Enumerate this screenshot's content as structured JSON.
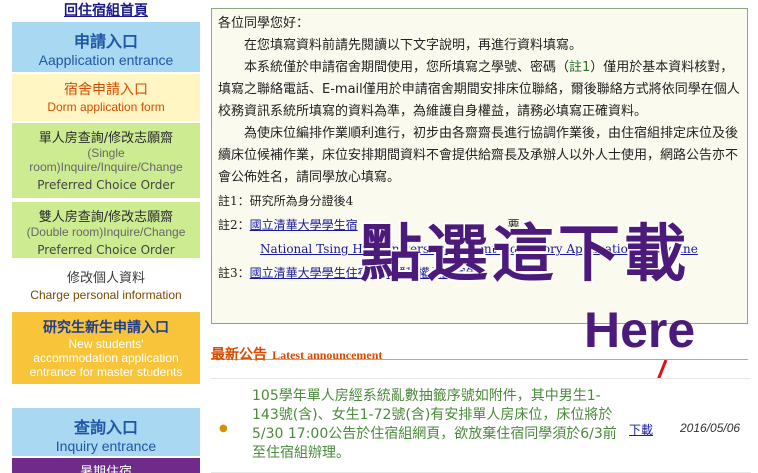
{
  "sidebar": {
    "home_link": "回住宿組首頁",
    "application_entrance": {
      "zh": "申請入口",
      "en": "Aapplication entrance"
    },
    "dorm_form": {
      "zh": "宿舍申請入口",
      "en": "Dorm application form"
    },
    "single_room": {
      "zh": "單人房查詢/修改志願齋",
      "en1": "(Single",
      "en2": "room)Inquire/Inquire/Change",
      "en3": "Preferred Choice Order"
    },
    "double_room": {
      "zh": "雙人房查詢/修改志願齋",
      "en1": "(Double room)Inquire/Change",
      "en2": "Preferred Choice Order"
    },
    "personal_data": {
      "zh": "修改個人資料",
      "en": "Charge personal information"
    },
    "grad_application": {
      "zh": "研究生新生申請入口",
      "en1": "New students'",
      "en2": "accommodation application",
      "en3": "entrance for master students"
    },
    "inquiry_entrance": {
      "zh": "查詢入口",
      "en": "Inquiry entrance"
    },
    "summer": {
      "zh": "暑期住宿"
    }
  },
  "notice": {
    "greeting": "各位同學您好：",
    "p1": "在您填寫資料前請先閱讀以下文字說明，再進行資料填寫。",
    "p2_a": "本系統僅於申請宿舍期間使用，您所填寫之學號、密碼（",
    "p2_note": "註1",
    "p2_b": "）僅用於基本資料核對，填寫之聯絡電話、E-mail僅用於申請宿舍期間安排床位聯絡，爾後聯絡方式將依同學在個人校務資訊系統所填寫的資料為準，為維護自身權益，請務必填寫正確資料。",
    "p3": "為使床位編排作業順利進行，初步由各齋齋長進行協調作業後，由住宿組排定床位及後續床位候補作業，床位安排期間資料不會提供給齋長及承辦人以外人士使用，網路公告亦不會公佈姓名，請同學放心填寫。",
    "note1_label": "註1：",
    "note1_text": "研究所為身分證後4",
    "note2_label": "註2：",
    "note2_link": "國立清華大學學生宿",
    "note2_suffix": "要",
    "note2_en_link": "National Tsing Hua University Student Dormitory Application Guideline",
    "note3_label": "註3：",
    "note3_link": "國立清華大學學生住宿資訊隱私權保護宣告",
    "note3_end": "。"
  },
  "overlay": {
    "zh": "點選這下載",
    "en": "Here"
  },
  "announcement": {
    "title_zh": "最新公告",
    "title_en": "Latest announcement",
    "items": [
      {
        "text": "105學年單人房經系統亂數抽籤序號如附件，其中男生1-143號(含)、女生1-72號(含)有安排單人房床位，床位將於5/30 17:00公告於住宿組網頁，欲放棄住宿同學須於6/3前至住宿組辦理。",
        "link": "下載",
        "date": "2016/05/06"
      }
    ]
  },
  "colors": {
    "section_blue": "#a9d8f2",
    "menu_green": "#cdec92",
    "grad_gold": "#f7c43a",
    "overlay_purple": "#4b1a7a",
    "announcement_orange": "#d94b00"
  }
}
